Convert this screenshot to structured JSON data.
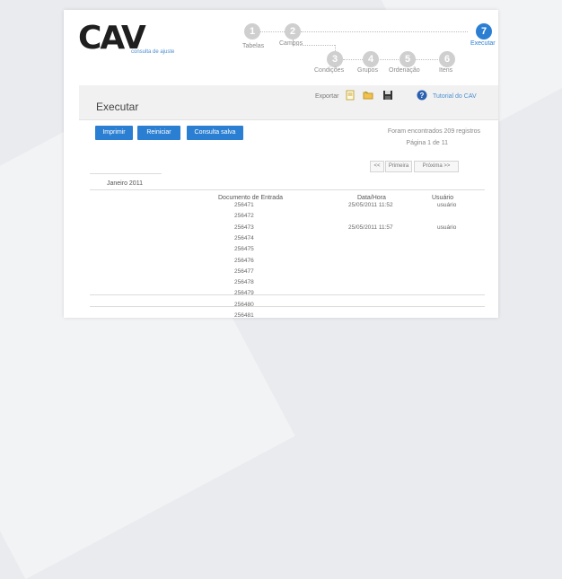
{
  "logo": {
    "text": "CAV",
    "subtitle": "consulta de ajuste"
  },
  "steps": [
    {
      "number": "1",
      "label": "Tabelas"
    },
    {
      "number": "2",
      "label": "Campos"
    },
    {
      "number": "3",
      "label": "Condições"
    },
    {
      "number": "4",
      "label": "Grupos"
    },
    {
      "number": "5",
      "label": "Ordenação"
    },
    {
      "number": "6",
      "label": "Itens"
    },
    {
      "number": "7",
      "label": "Executar"
    }
  ],
  "header": {
    "title": "Executar",
    "toolbar_label": "Exportar",
    "help_label": "Tutorial do CAV"
  },
  "buttons": {
    "primary": "Imprimir",
    "second": "Reiniciar",
    "third": "Consulta salva"
  },
  "results": {
    "summary": "Foram encontrados 209 registros",
    "page_info": "Página 1 de 11",
    "prev_label": "<<",
    "first_label": "Primeira",
    "next_label": "Próxima >>"
  },
  "table": {
    "group_label": "Janeiro 2011",
    "columns": [
      "Documento de Entrada",
      "Data/Hora",
      "Usuário"
    ],
    "rows": [
      [
        "256471",
        "25/05/2011 11:52",
        "usuário"
      ],
      [
        "256472",
        "",
        ""
      ],
      [
        "256473",
        "25/05/2011 11:57",
        "usuário"
      ],
      [
        "256474",
        "",
        ""
      ],
      [
        "256475",
        "",
        ""
      ],
      [
        "256476",
        "",
        ""
      ],
      [
        "256477",
        "",
        ""
      ],
      [
        "256478",
        "",
        ""
      ],
      [
        "256479",
        "",
        ""
      ],
      [
        "256480",
        "",
        ""
      ],
      [
        "256481",
        "",
        ""
      ]
    ]
  },
  "colors": {
    "accent": "#2b7fd2",
    "step_inactive": "#cfcfcf"
  }
}
